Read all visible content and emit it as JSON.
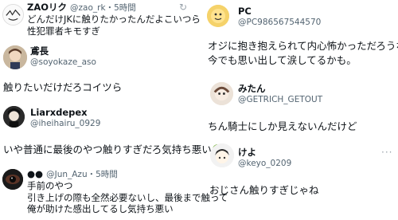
{
  "left": {
    "post1": {
      "name": "ZAOリク",
      "handle": "@zao_rk",
      "time": "5時間",
      "lines": [
        "どんだけJKに触りたかったんだよこいつら",
        "性犯罪者キモすぎ"
      ]
    },
    "post2": {
      "name": "鳶長",
      "handle": "@soyokaze_aso",
      "text": "触りたいだけだろコイツら"
    },
    "post3": {
      "name": "Liarxdepex",
      "handle": "@iheihairu_0929",
      "text": "いや普通に最後のやつ触りすぎだろ気持ち悪い"
    },
    "post4": {
      "name": "●●",
      "handle": "@Jun_Azu",
      "time": "5時間",
      "lines": [
        "手前のやつ",
        "引き上げの際も全然必要ないし、最後まで触って",
        "俺が助けた感出してるし気持ち悪い"
      ]
    }
  },
  "right": {
    "post1": {
      "name": "PC",
      "handle": "@PC986567544570",
      "lines": [
        "オジに抱き抱えられて内心怖かっただろうな。",
        "今でも思い出して涙してるかも。"
      ]
    },
    "post2": {
      "name": "みたん",
      "handle": "@GETRICH_GETOUT",
      "text": "ちん騎士にしか見えないんだけど"
    },
    "post3": {
      "name": "けよ",
      "handle": "@keyo_0209",
      "text": "おじさん触りすぎじゃね"
    }
  },
  "icons": {
    "left": "refresh-icon",
    "right": "more-icon"
  },
  "colors": {
    "handle": "#536471",
    "text": "#0f1419",
    "emoji": "#7cb342"
  }
}
